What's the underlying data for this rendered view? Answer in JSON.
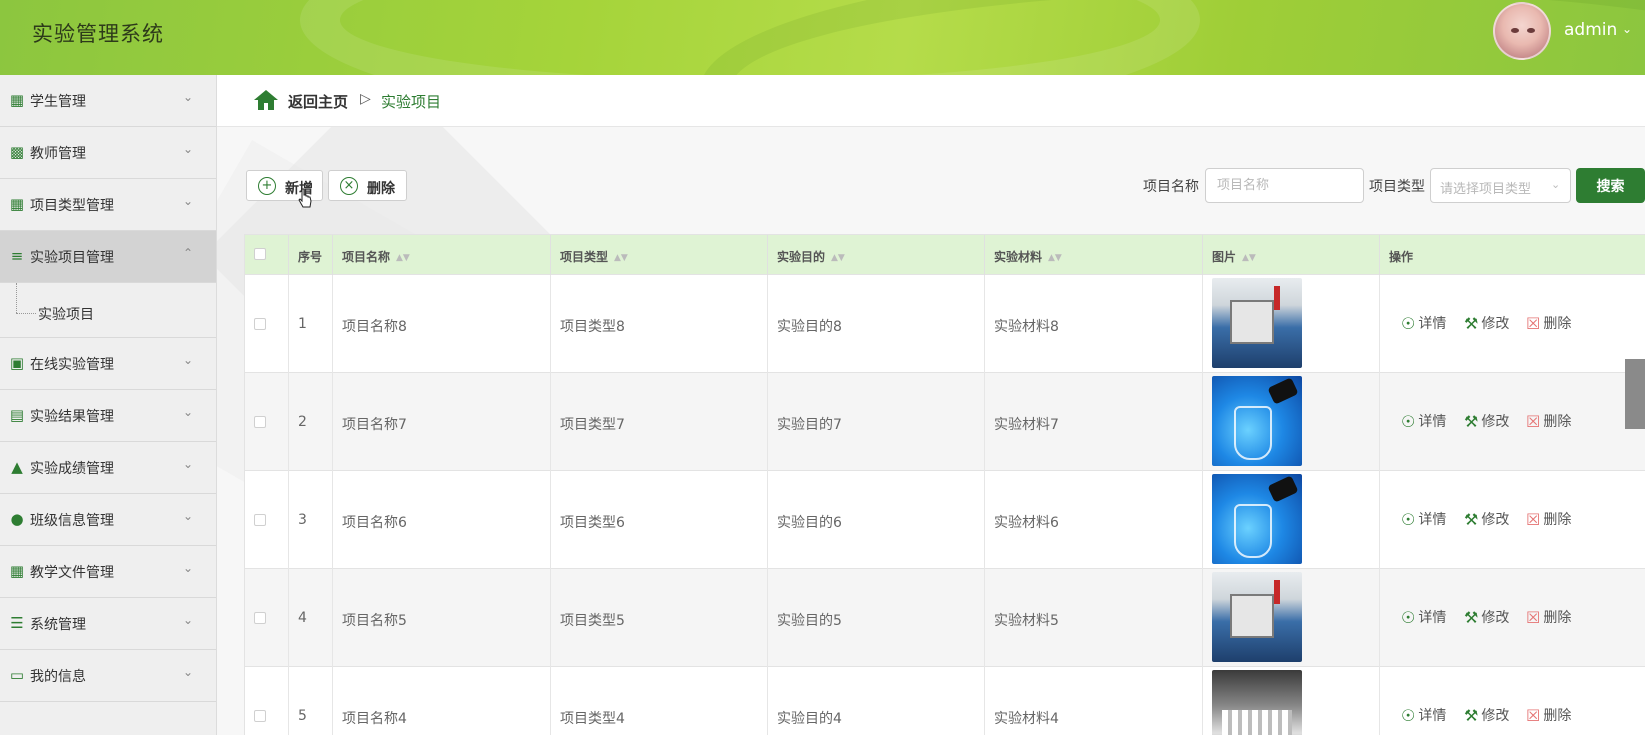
{
  "app": {
    "title": "实验管理系统",
    "username": "admin"
  },
  "sidebar": {
    "items": [
      {
        "label": "学生管理",
        "icon": "grid-icon"
      },
      {
        "label": "教师管理",
        "icon": "bar-chart-icon"
      },
      {
        "label": "项目类型管理",
        "icon": "grid-icon"
      },
      {
        "label": "实验项目管理",
        "icon": "sliders-icon",
        "active": true,
        "expanded": true
      },
      {
        "label": "在线实验管理",
        "icon": "clipboard-icon"
      },
      {
        "label": "实验结果管理",
        "icon": "book-icon"
      },
      {
        "label": "实验成绩管理",
        "icon": "stamp-icon"
      },
      {
        "label": "班级信息管理",
        "icon": "user-icon"
      },
      {
        "label": "教学文件管理",
        "icon": "apps-icon"
      },
      {
        "label": "系统管理",
        "icon": "list-icon"
      },
      {
        "label": "我的信息",
        "icon": "card-icon"
      }
    ],
    "sub_item": "实验项目"
  },
  "breadcrumb": {
    "home": "返回主页",
    "separator": "▷",
    "current": "实验项目"
  },
  "toolbar": {
    "add_label": "新增",
    "delete_label": "删除"
  },
  "search": {
    "name_label": "项目名称",
    "name_placeholder": "项目名称",
    "type_label": "项目类型",
    "type_placeholder": "请选择项目类型",
    "button_label": "搜索"
  },
  "table": {
    "headers": [
      "序号",
      "项目名称",
      "项目类型",
      "实验目的",
      "实验材料",
      "图片",
      "操作"
    ],
    "actions": {
      "detail": "详情",
      "edit": "修改",
      "delete": "删除"
    },
    "rows": [
      {
        "index": "1",
        "name": "项目名称8",
        "type": "项目类型8",
        "purpose": "实验目的8",
        "material": "实验材料8",
        "image": "lab"
      },
      {
        "index": "2",
        "name": "项目名称7",
        "type": "项目类型7",
        "purpose": "实验目的7",
        "material": "实验材料7",
        "image": "flask"
      },
      {
        "index": "3",
        "name": "项目名称6",
        "type": "项目类型6",
        "purpose": "实验目的6",
        "material": "实验材料6",
        "image": "flask"
      },
      {
        "index": "4",
        "name": "项目名称5",
        "type": "项目类型5",
        "purpose": "实验目的5",
        "material": "实验材料5",
        "image": "lab"
      },
      {
        "index": "5",
        "name": "项目名称4",
        "type": "项目类型4",
        "purpose": "实验目的4",
        "material": "实验材料4",
        "image": "rack"
      }
    ]
  },
  "colors": {
    "header_green": "#9fce37",
    "accent_green": "#2e7d32",
    "table_head_bg": "#dff3d4",
    "delete_red": "#e57373"
  }
}
